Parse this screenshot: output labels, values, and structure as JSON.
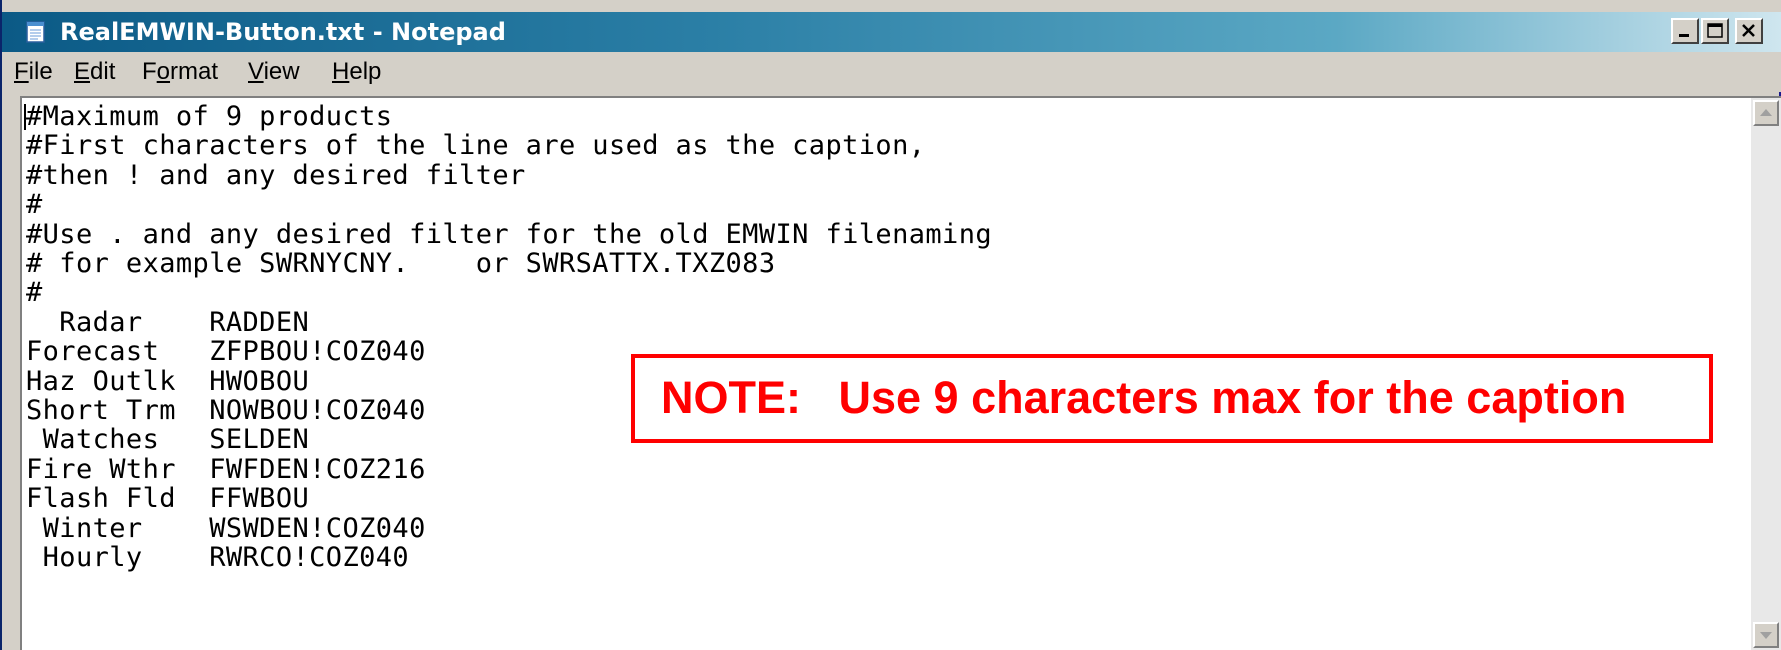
{
  "window": {
    "title": "RealEMWIN-Button.txt - Notepad",
    "app_icon": "notepad-icon",
    "title_gradient": [
      "#0b5a86",
      "#cfe6ef"
    ]
  },
  "window_controls": {
    "minimize_icon": "minimize-icon",
    "maximize_icon": "maximize-icon",
    "close_icon": "close-icon"
  },
  "menu": {
    "items": [
      {
        "label": "File",
        "mnemonic": "F",
        "rest": "ile"
      },
      {
        "label": "Edit",
        "mnemonic": "E",
        "rest": "dit"
      },
      {
        "label": "Format",
        "pre": "F",
        "mnemonic": "o",
        "rest": "rmat"
      },
      {
        "label": "View",
        "mnemonic": "V",
        "rest": "iew"
      },
      {
        "label": "Help",
        "mnemonic": "H",
        "rest": "elp"
      }
    ]
  },
  "editor": {
    "lines": [
      "#Maximum of 9 products",
      "#First characters of the line are used as the caption,",
      "#then ! and any desired filter",
      "#",
      "#Use . and any desired filter for the old EMWIN filenaming",
      "# for example SWRNYCNY.    or SWRSATTX.TXZ083",
      "#",
      "  Radar    RADDEN",
      "Forecast   ZFPBOU!COZ040",
      "Haz Outlk  HWOBOU",
      "Short Trm  NOWBOU!COZ040",
      " Watches   SELDEN",
      "Fire Wthr  FWFDEN!COZ216",
      "Flash Fld  FFWBOU",
      " Winter    WSWDEN!COZ040",
      " Hourly    RWRCO!COZ040"
    ]
  },
  "scrollbar": {
    "up_icon": "scroll-up-arrow-icon",
    "down_icon": "scroll-down-arrow-icon"
  },
  "note": {
    "text": "NOTE:   Use 9 characters max for the caption",
    "color": "#ff0000"
  }
}
